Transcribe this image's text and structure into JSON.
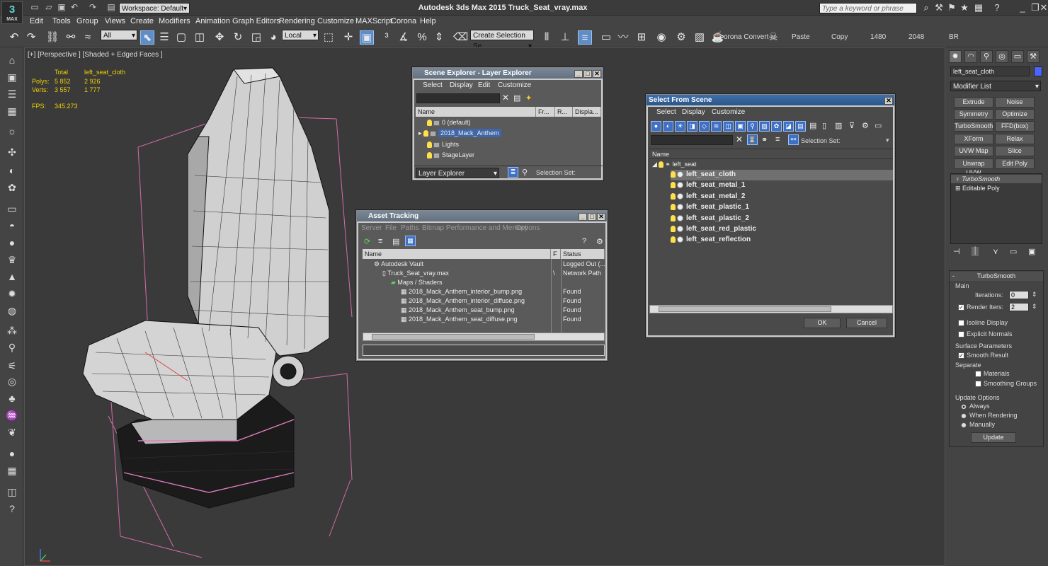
{
  "app": {
    "title": "Autodesk 3ds Max  2015     Truck_Seat_vray.max",
    "logo": "MAX",
    "workspace": "Workspace: Default",
    "search_placeholder": "Type a keyword or phrase"
  },
  "menu": [
    "Edit",
    "Tools",
    "Group",
    "Views",
    "Create",
    "Modifiers",
    "Animation",
    "Graph Editors",
    "Rendering",
    "Customize",
    "MAXScript",
    "Corona",
    "Help"
  ],
  "toolbar": {
    "filter": "All",
    "coord": "Local",
    "selection_set": "Create Selection Se",
    "corona_convert": "orona Convert",
    "labels": [
      "Paste",
      "Copy",
      "1480",
      "2048",
      "BR"
    ]
  },
  "viewport": {
    "label": "[+] [Perspective ] [Shaded + Edged Faces ]",
    "stats": {
      "col_total": "Total",
      "col_object": "left_seat_cloth",
      "polys_label": "Polys:",
      "polys_total": "5 852",
      "polys_obj": "2 926",
      "verts_label": "Verts:",
      "verts_total": "3 557",
      "verts_obj": "1 777",
      "fps_label": "FPS:",
      "fps": "345.273"
    }
  },
  "scene_explorer": {
    "title": "Scene Explorer - Layer Explorer",
    "menu": [
      "Select",
      "Display",
      "Edit",
      "Customize"
    ],
    "columns": [
      "Name",
      "Fr...",
      "R...",
      "Displa..."
    ],
    "rows": [
      "0 (default)",
      "2018_Mack_Anthem",
      "Lights",
      "StageLayer"
    ],
    "footer_dropdown": "Layer Explorer",
    "footer_label": "Selection Set:"
  },
  "asset_tracking": {
    "title": "Asset Tracking",
    "menu": [
      "Server",
      "File",
      "Paths",
      "Bitmap Performance and Memory",
      "Options"
    ],
    "columns": [
      "Name",
      "F",
      "Status"
    ],
    "rows": [
      {
        "name": "Autodesk Vault",
        "f": "",
        "status": "Logged Out (..."
      },
      {
        "name": "Truck_Seat_vray.max",
        "f": "\\",
        "status": "Network Path"
      },
      {
        "name": "Maps / Shaders",
        "f": "",
        "status": ""
      },
      {
        "name": "2018_Mack_Anthem_interior_bump.png",
        "f": "",
        "status": "Found"
      },
      {
        "name": "2018_Mack_Anthem_interior_diffuse.png",
        "f": "",
        "status": "Found"
      },
      {
        "name": "2018_Mack_Anthem_seat_bump.png",
        "f": "",
        "status": "Found"
      },
      {
        "name": "2018_Mack_Anthem_seat_diffuse.png",
        "f": "",
        "status": "Found"
      }
    ]
  },
  "select_from_scene": {
    "title": "Select From Scene",
    "menu": [
      "Select",
      "Display",
      "Customize"
    ],
    "selection_set_label": "Selection Set:",
    "column": "Name",
    "root": "left_seat",
    "items": [
      "left_seat_cloth",
      "left_seat_metal_1",
      "left_seat_metal_2",
      "left_seat_plastic_1",
      "left_seat_plastic_2",
      "left_seat_red_plastic",
      "left_seat_reflection"
    ],
    "ok": "OK",
    "cancel": "Cancel"
  },
  "command_panel": {
    "object_name": "left_seat_cloth",
    "modifier_list": "Modifier List",
    "buttons": [
      "Extrude",
      "Noise",
      "Symmetry",
      "Optimize",
      "TurboSmooth",
      "FFD(box)",
      "XForm",
      "Relax",
      "UVW Map",
      "Slice",
      "Unwrap UVW",
      "Edit Poly"
    ],
    "stack": [
      "TurboSmooth",
      "Editable Poly"
    ],
    "rollout": {
      "title": "TurboSmooth",
      "main": "Main",
      "iterations_label": "Iterations:",
      "iterations": "0",
      "render_iters_label": "Render Iters:",
      "render_iters": "2",
      "isoline": "Isoline Display",
      "explicit": "Explicit Normals",
      "surface": "Surface Parameters",
      "smooth_result": "Smooth Result",
      "separate": "Separate",
      "materials": "Materials",
      "smoothing_groups": "Smoothing Groups",
      "update_options": "Update Options",
      "always": "Always",
      "when_rendering": "When Rendering",
      "manually": "Manually",
      "update": "Update"
    }
  }
}
